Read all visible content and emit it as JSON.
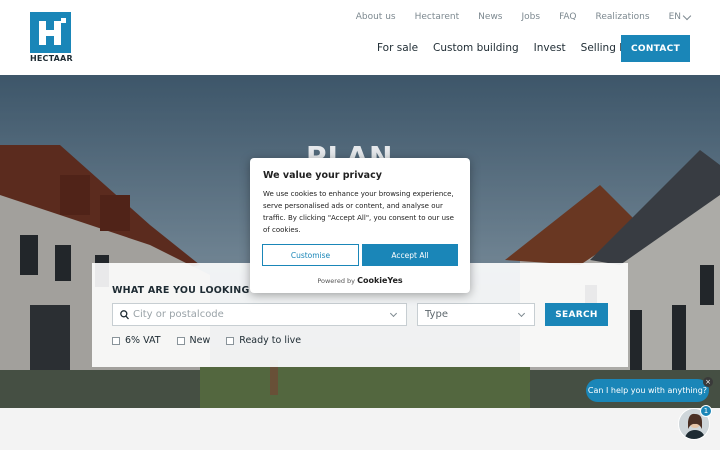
{
  "brand": {
    "name": "HECTAAR",
    "color": "#1a86b8"
  },
  "topnav": [
    {
      "label": "About us"
    },
    {
      "label": "Hectarent"
    },
    {
      "label": "News"
    },
    {
      "label": "Jobs"
    },
    {
      "label": "FAQ"
    },
    {
      "label": "Realizations"
    }
  ],
  "language": "EN",
  "mainnav": [
    {
      "label": "For sale"
    },
    {
      "label": "Custom building"
    },
    {
      "label": "Invest"
    },
    {
      "label": "Selling land"
    }
  ],
  "contact_label": "CONTACT",
  "hero": {
    "title": "PLAN"
  },
  "search": {
    "title": "WHAT ARE YOU LOOKING FOR",
    "city_placeholder": "City or postalcode",
    "type_value": "Type",
    "button": "SEARCH",
    "filters": [
      {
        "label": "6% VAT"
      },
      {
        "label": "New"
      },
      {
        "label": "Ready to live"
      }
    ]
  },
  "cookie": {
    "title": "We value your privacy",
    "text": "We use cookies to enhance your browsing experience, serve personalised ads or content, and analyse our traffic. By clicking \"Accept All\", you consent to our use of cookies.",
    "customise": "Customise",
    "accept": "Accept All",
    "powered_by": "Powered by",
    "provider": "CookieYes"
  },
  "chat": {
    "prompt": "Can I help you with anything?",
    "close": "×",
    "badge": "1"
  }
}
